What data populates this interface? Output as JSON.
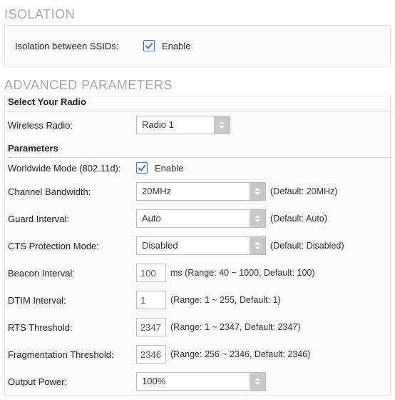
{
  "isolation": {
    "title": "ISOLATION",
    "row": {
      "label": "Isolation between SSIDs:",
      "checkbox_text": "Enable",
      "checked": true
    }
  },
  "advanced": {
    "title": "ADVANCED PARAMETERS",
    "select_radio_header": "Select Your Radio",
    "wireless_radio": {
      "label": "Wireless Radio:",
      "value": "Radio 1"
    },
    "parameters_header": "Parameters",
    "worldwide": {
      "label": "Worldwide Mode (802.11d):",
      "checkbox_text": "Enable",
      "checked": true
    },
    "channel_bw": {
      "label": "Channel Bandwidth:",
      "value": "20MHz",
      "hint": "(Default: 20MHz)"
    },
    "guard_interval": {
      "label": "Guard Interval:",
      "value": "Auto",
      "hint": "(Default: Auto)"
    },
    "cts": {
      "label": "CTS Protection Mode:",
      "value": "Disabled",
      "hint": "(Default: Disabled)"
    },
    "beacon": {
      "label": "Beacon Interval:",
      "value": "100",
      "hint": "ms (Range: 40 ~ 1000, Default: 100)"
    },
    "dtim": {
      "label": "DTIM Interval:",
      "value": "1",
      "hint": "(Range: 1 ~ 255, Default: 1)"
    },
    "rts": {
      "label": "RTS Threshold:",
      "value": "2347",
      "hint": "(Range: 1 ~ 2347, Default: 2347)"
    },
    "frag": {
      "label": "Fragmentation Threshold:",
      "value": "2346",
      "hint": "(Range: 256 ~ 2346, Default: 2346)"
    },
    "power": {
      "label": "Output Power:",
      "value": "100%"
    }
  }
}
